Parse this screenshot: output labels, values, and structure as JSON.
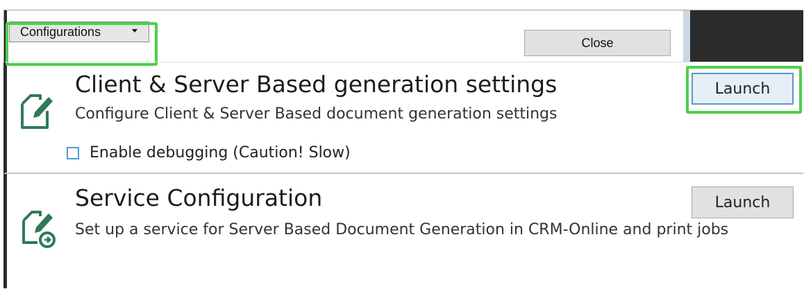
{
  "toolbar": {
    "configurations_label": "Configurations",
    "close_label": "Close"
  },
  "panels": [
    {
      "title": "Client & Server Based generation settings",
      "description": "Configure Client & Server Based document generation settings",
      "launch_label": "Launch",
      "checkbox_label": "Enable debugging (Caution! Slow)",
      "checkbox_checked": false,
      "icon": "document-edit-icon"
    },
    {
      "title": "Service Configuration",
      "description": "Set up a service for Server Based Document Generation in CRM-Online and print jobs",
      "launch_label": "Launch",
      "icon": "document-service-icon"
    }
  ],
  "colors": {
    "highlight": "#4cd04c",
    "icon_green": "#2f7a58",
    "checkbox_border": "#4e9ad4"
  }
}
